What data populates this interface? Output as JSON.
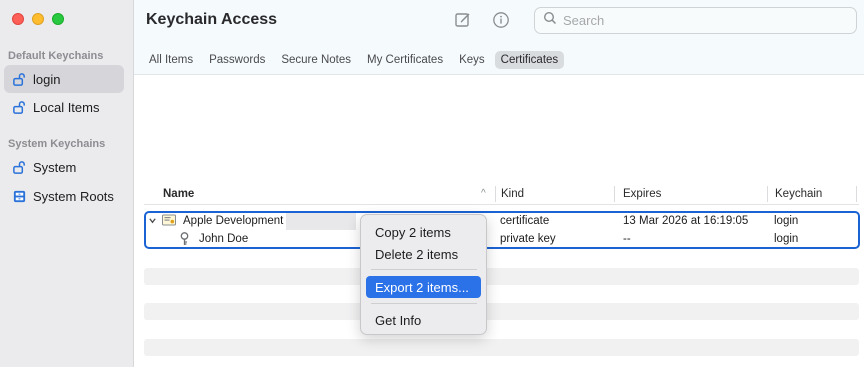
{
  "window": {
    "title": "Keychain Access",
    "traffic_lights": [
      "close",
      "minimize",
      "zoom"
    ]
  },
  "sidebar": {
    "sections": [
      {
        "title": "Default Keychains",
        "items": [
          {
            "label": "login",
            "icon": "lock-open-icon",
            "selected": true
          },
          {
            "label": "Local Items",
            "icon": "lock-open-icon",
            "selected": false
          }
        ]
      },
      {
        "title": "System Keychains",
        "items": [
          {
            "label": "System",
            "icon": "lock-open-icon",
            "selected": false
          },
          {
            "label": "System Roots",
            "icon": "cabinet-icon",
            "selected": false
          }
        ]
      }
    ]
  },
  "toolbar": {
    "compose_icon": "compose-icon",
    "info_icon": "info-icon",
    "search_placeholder": "Search"
  },
  "tabs": [
    {
      "label": "All Items",
      "active": false
    },
    {
      "label": "Passwords",
      "active": false
    },
    {
      "label": "Secure Notes",
      "active": false
    },
    {
      "label": "My Certificates",
      "active": false
    },
    {
      "label": "Keys",
      "active": false
    },
    {
      "label": "Certificates",
      "active": true
    }
  ],
  "table": {
    "columns": [
      "Name",
      "Kind",
      "Expires",
      "Keychain"
    ],
    "sort_indicator": "^",
    "rows": [
      {
        "name": "Apple Development",
        "kind": "certificate",
        "expires": "13 Mar 2026 at 16:19:05",
        "keychain": "login",
        "icon": "certificate-icon"
      },
      {
        "name": "John Doe",
        "kind": "private key",
        "expires": "--",
        "keychain": "login",
        "icon": "key-icon"
      }
    ]
  },
  "context_menu": {
    "items": [
      {
        "label": "Copy 2 items",
        "highlighted": false
      },
      {
        "label": "Delete 2 items",
        "highlighted": false
      },
      {
        "label": "Export 2 items...",
        "highlighted": true
      },
      {
        "label": "Get Info",
        "highlighted": false
      }
    ]
  },
  "colors": {
    "accent": "#2b71e8",
    "selection_border": "#1a63d4",
    "sidebar_bg": "#ebebed"
  }
}
